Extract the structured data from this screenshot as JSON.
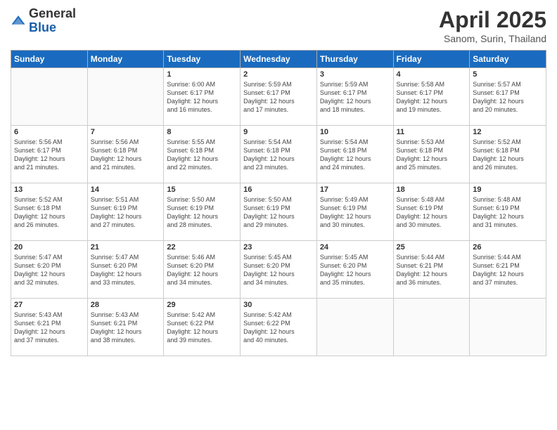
{
  "logo": {
    "general": "General",
    "blue": "Blue"
  },
  "title": "April 2025",
  "subtitle": "Sanom, Surin, Thailand",
  "days_of_week": [
    "Sunday",
    "Monday",
    "Tuesday",
    "Wednesday",
    "Thursday",
    "Friday",
    "Saturday"
  ],
  "weeks": [
    [
      {
        "day": "",
        "info": ""
      },
      {
        "day": "",
        "info": ""
      },
      {
        "day": "1",
        "info": "Sunrise: 6:00 AM\nSunset: 6:17 PM\nDaylight: 12 hours\nand 16 minutes."
      },
      {
        "day": "2",
        "info": "Sunrise: 5:59 AM\nSunset: 6:17 PM\nDaylight: 12 hours\nand 17 minutes."
      },
      {
        "day": "3",
        "info": "Sunrise: 5:59 AM\nSunset: 6:17 PM\nDaylight: 12 hours\nand 18 minutes."
      },
      {
        "day": "4",
        "info": "Sunrise: 5:58 AM\nSunset: 6:17 PM\nDaylight: 12 hours\nand 19 minutes."
      },
      {
        "day": "5",
        "info": "Sunrise: 5:57 AM\nSunset: 6:17 PM\nDaylight: 12 hours\nand 20 minutes."
      }
    ],
    [
      {
        "day": "6",
        "info": "Sunrise: 5:56 AM\nSunset: 6:17 PM\nDaylight: 12 hours\nand 21 minutes."
      },
      {
        "day": "7",
        "info": "Sunrise: 5:56 AM\nSunset: 6:18 PM\nDaylight: 12 hours\nand 21 minutes."
      },
      {
        "day": "8",
        "info": "Sunrise: 5:55 AM\nSunset: 6:18 PM\nDaylight: 12 hours\nand 22 minutes."
      },
      {
        "day": "9",
        "info": "Sunrise: 5:54 AM\nSunset: 6:18 PM\nDaylight: 12 hours\nand 23 minutes."
      },
      {
        "day": "10",
        "info": "Sunrise: 5:54 AM\nSunset: 6:18 PM\nDaylight: 12 hours\nand 24 minutes."
      },
      {
        "day": "11",
        "info": "Sunrise: 5:53 AM\nSunset: 6:18 PM\nDaylight: 12 hours\nand 25 minutes."
      },
      {
        "day": "12",
        "info": "Sunrise: 5:52 AM\nSunset: 6:18 PM\nDaylight: 12 hours\nand 26 minutes."
      }
    ],
    [
      {
        "day": "13",
        "info": "Sunrise: 5:52 AM\nSunset: 6:18 PM\nDaylight: 12 hours\nand 26 minutes."
      },
      {
        "day": "14",
        "info": "Sunrise: 5:51 AM\nSunset: 6:19 PM\nDaylight: 12 hours\nand 27 minutes."
      },
      {
        "day": "15",
        "info": "Sunrise: 5:50 AM\nSunset: 6:19 PM\nDaylight: 12 hours\nand 28 minutes."
      },
      {
        "day": "16",
        "info": "Sunrise: 5:50 AM\nSunset: 6:19 PM\nDaylight: 12 hours\nand 29 minutes."
      },
      {
        "day": "17",
        "info": "Sunrise: 5:49 AM\nSunset: 6:19 PM\nDaylight: 12 hours\nand 30 minutes."
      },
      {
        "day": "18",
        "info": "Sunrise: 5:48 AM\nSunset: 6:19 PM\nDaylight: 12 hours\nand 30 minutes."
      },
      {
        "day": "19",
        "info": "Sunrise: 5:48 AM\nSunset: 6:19 PM\nDaylight: 12 hours\nand 31 minutes."
      }
    ],
    [
      {
        "day": "20",
        "info": "Sunrise: 5:47 AM\nSunset: 6:20 PM\nDaylight: 12 hours\nand 32 minutes."
      },
      {
        "day": "21",
        "info": "Sunrise: 5:47 AM\nSunset: 6:20 PM\nDaylight: 12 hours\nand 33 minutes."
      },
      {
        "day": "22",
        "info": "Sunrise: 5:46 AM\nSunset: 6:20 PM\nDaylight: 12 hours\nand 34 minutes."
      },
      {
        "day": "23",
        "info": "Sunrise: 5:45 AM\nSunset: 6:20 PM\nDaylight: 12 hours\nand 34 minutes."
      },
      {
        "day": "24",
        "info": "Sunrise: 5:45 AM\nSunset: 6:20 PM\nDaylight: 12 hours\nand 35 minutes."
      },
      {
        "day": "25",
        "info": "Sunrise: 5:44 AM\nSunset: 6:21 PM\nDaylight: 12 hours\nand 36 minutes."
      },
      {
        "day": "26",
        "info": "Sunrise: 5:44 AM\nSunset: 6:21 PM\nDaylight: 12 hours\nand 37 minutes."
      }
    ],
    [
      {
        "day": "27",
        "info": "Sunrise: 5:43 AM\nSunset: 6:21 PM\nDaylight: 12 hours\nand 37 minutes."
      },
      {
        "day": "28",
        "info": "Sunrise: 5:43 AM\nSunset: 6:21 PM\nDaylight: 12 hours\nand 38 minutes."
      },
      {
        "day": "29",
        "info": "Sunrise: 5:42 AM\nSunset: 6:22 PM\nDaylight: 12 hours\nand 39 minutes."
      },
      {
        "day": "30",
        "info": "Sunrise: 5:42 AM\nSunset: 6:22 PM\nDaylight: 12 hours\nand 40 minutes."
      },
      {
        "day": "",
        "info": ""
      },
      {
        "day": "",
        "info": ""
      },
      {
        "day": "",
        "info": ""
      }
    ]
  ]
}
